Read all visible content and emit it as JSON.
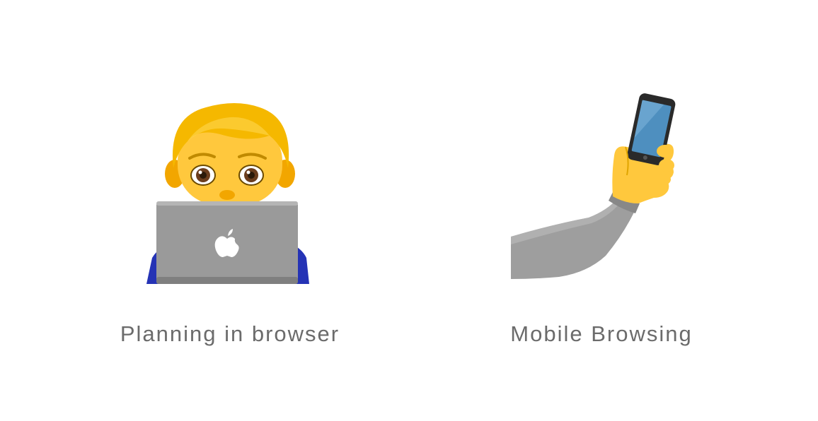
{
  "items": [
    {
      "label": "Planning in browser",
      "icon": "man-technologist-icon"
    },
    {
      "label": "Mobile Browsing",
      "icon": "selfie-phone-icon"
    }
  ],
  "colors": {
    "text": "#6b6b6b",
    "skin": "#FFC83D",
    "hair": "#F5B800",
    "laptop": "#9A9A9A",
    "shirt": "#2533B5",
    "sleeve": "#9E9E9E",
    "phone_screen": "#4E8FBF"
  }
}
